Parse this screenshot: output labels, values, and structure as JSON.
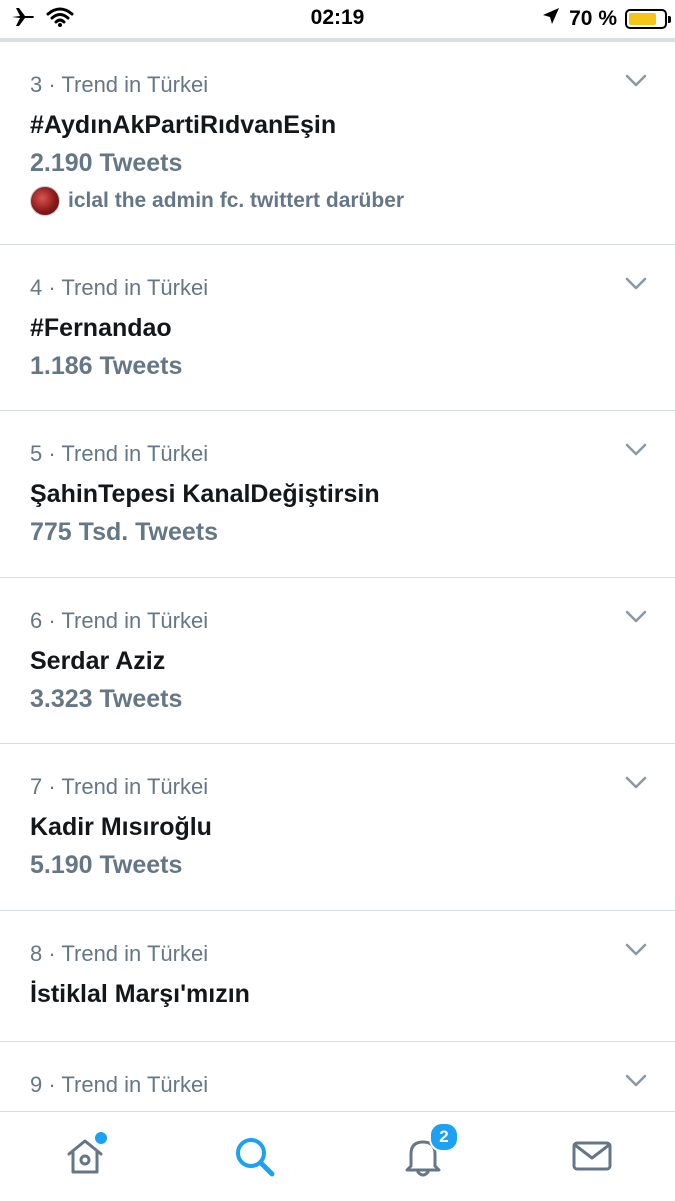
{
  "status_bar": {
    "time": "02:19",
    "battery_percent": "70 %",
    "icons": [
      "airplane-icon",
      "wifi-icon",
      "location-arrow-icon",
      "battery-icon"
    ]
  },
  "trends": [
    {
      "meta": "3 · Trend in Türkei",
      "name": "#AydınAkPartiRıdvanEşin",
      "count": "2.190 Tweets",
      "context": "iclal the admin fc. twittert darüber"
    },
    {
      "meta": "4 · Trend in Türkei",
      "name": "#Fernandao",
      "count": "1.186 Tweets"
    },
    {
      "meta": "5 · Trend in Türkei",
      "name": "ŞahinTepesi KanalDeğiştirsin",
      "count": "775 Tsd. Tweets"
    },
    {
      "meta": "6 · Trend in Türkei",
      "name": "Serdar Aziz",
      "count": "3.323 Tweets"
    },
    {
      "meta": "7 · Trend in Türkei",
      "name": "Kadir Mısıroğlu",
      "count": "5.190 Tweets"
    },
    {
      "meta": "8 · Trend in Türkei",
      "name": "İstiklal Marşı'mızın"
    },
    {
      "meta": "9 · Trend in Türkei"
    }
  ],
  "tab_bar": {
    "tabs": [
      "home-icon",
      "search-icon",
      "notifications-icon",
      "messages-icon"
    ],
    "notifications_badge": "2",
    "active_tab": "search",
    "accent_color": "#1da1f2"
  }
}
